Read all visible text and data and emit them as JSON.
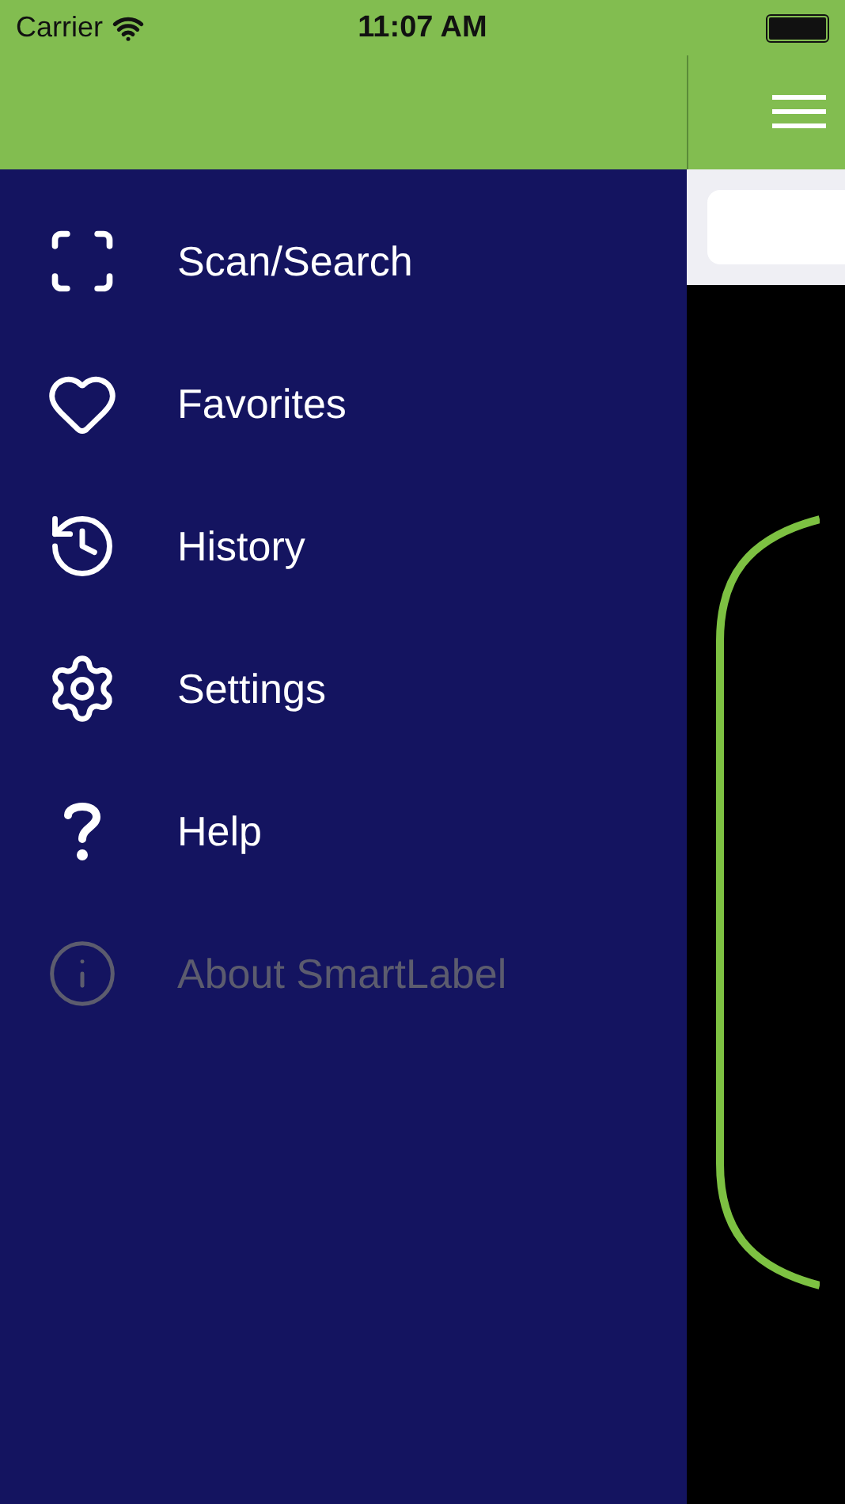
{
  "status_bar": {
    "carrier": "Carrier",
    "time": "11:07 AM"
  },
  "menu": [
    {
      "kind": "scan",
      "label": "Scan/Search",
      "disabled": false
    },
    {
      "kind": "heart",
      "label": "Favorites",
      "disabled": false
    },
    {
      "kind": "history",
      "label": "History",
      "disabled": false
    },
    {
      "kind": "gear",
      "label": "Settings",
      "disabled": false
    },
    {
      "kind": "question",
      "label": "Help",
      "disabled": false
    },
    {
      "kind": "info",
      "label": "About SmartLabel",
      "disabled": true
    }
  ]
}
